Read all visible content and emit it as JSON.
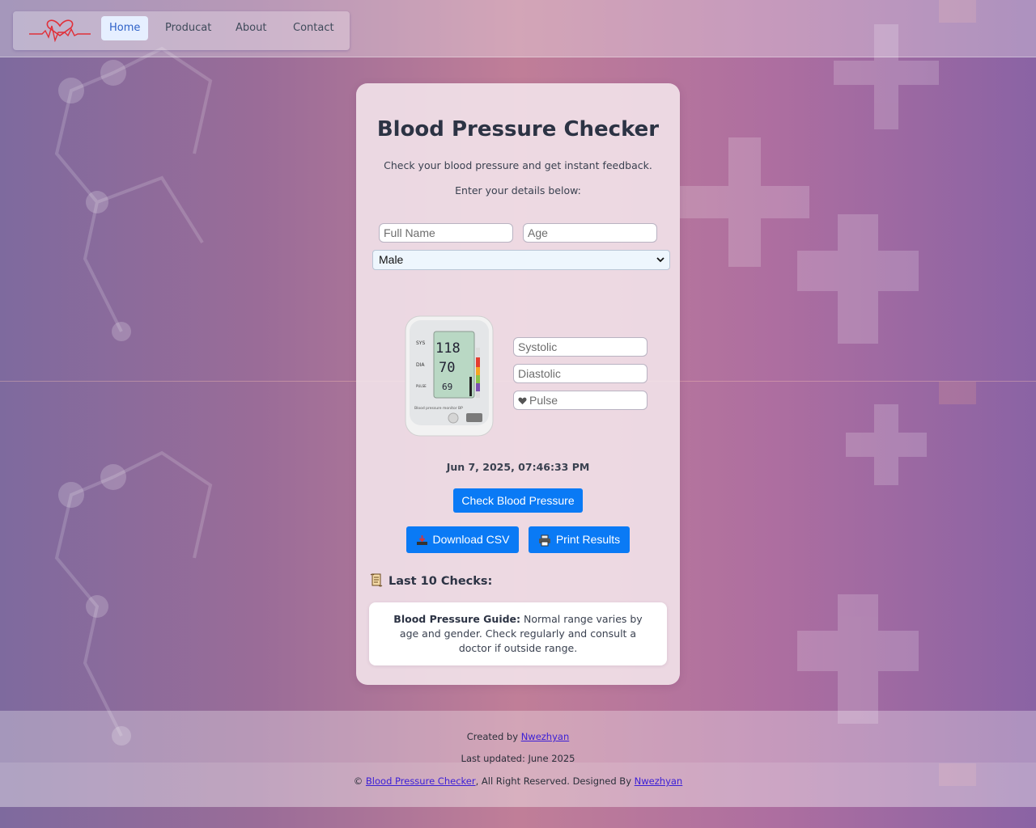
{
  "nav": {
    "items": [
      "Home",
      "Producat",
      "About",
      "Contact"
    ],
    "active": "Home"
  },
  "card": {
    "title": "Blood Pressure Checker",
    "subtitle": "Check your blood pressure and get instant feedback.",
    "instructions": "Enter your details below:",
    "fields": {
      "full_name_placeholder": "Full Name",
      "age_placeholder": "Age",
      "gender_selected": "Male",
      "systolic_placeholder": "Systolic",
      "diastolic_placeholder": "Diastolic",
      "pulse_placeholder": "Pulse"
    },
    "device_display": {
      "sys_label": "SYS",
      "dia_label": "DIA",
      "pulse_label": "PULSE",
      "sys_value": "118",
      "dia_value": "70",
      "pulse_value": "69",
      "caption": "Blood pressure monitor BP"
    },
    "timestamp": "Jun 7, 2025, 07:46:33 PM",
    "buttons": {
      "check": "Check Blood Pressure",
      "download": "Download CSV",
      "print": "Print Results"
    },
    "last_checks_title": "Last 10 Checks:",
    "guide": {
      "label": "Blood Pressure Guide:",
      "text": " Normal range varies by age and gender. Check regularly and consult a doctor if outside range."
    }
  },
  "footer": {
    "created_prefix": "Created by ",
    "author": "Nwezhyan",
    "last_updated": "Last updated: June 2025",
    "copyright_prefix": "© ",
    "site_link": "Blood Pressure Checker",
    "copyright_mid": ", All Right Reserved. Designed By ",
    "designer": "Nwezhyan"
  },
  "colors": {
    "primary_button": "#0a7af5",
    "active_nav_bg": "#e6efff",
    "logo_red": "#e0303a"
  }
}
